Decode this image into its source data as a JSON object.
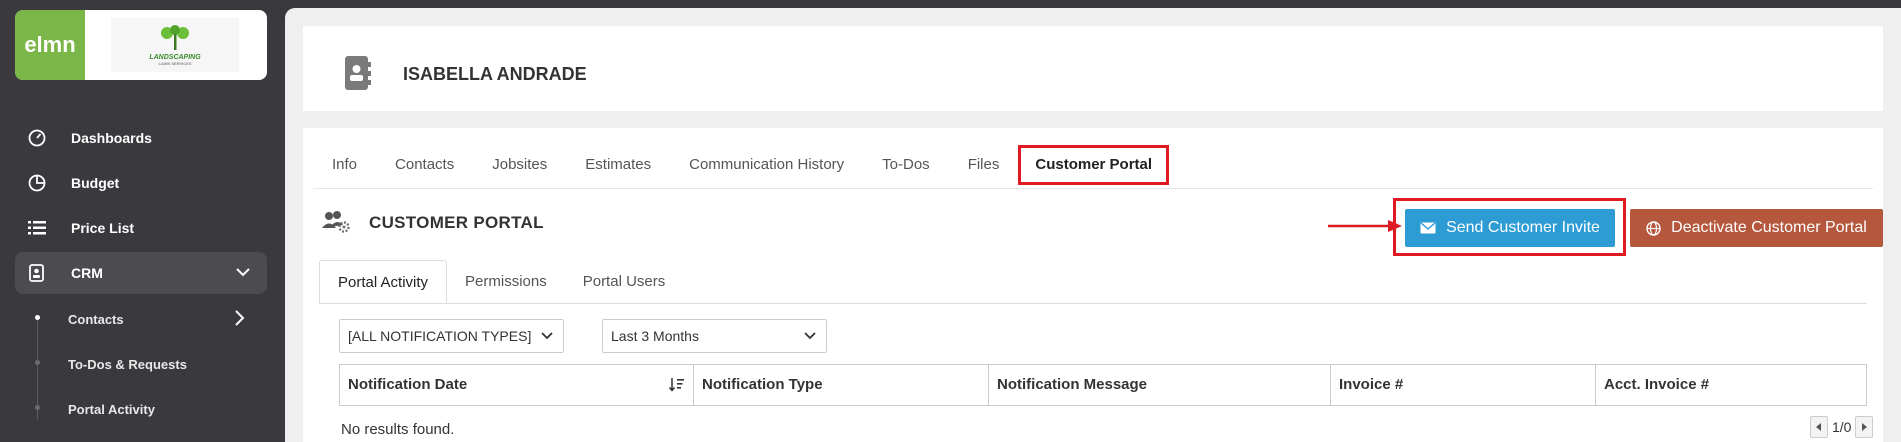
{
  "brand": {
    "app_logo": "elmn",
    "company_logo_text": "LANDSCAPING",
    "company_logo_subtext": "LAWN SERVICES",
    "accent": "#7ab648"
  },
  "sidebar": {
    "items": [
      {
        "label": "Dashboards",
        "icon": "gauge-icon"
      },
      {
        "label": "Budget",
        "icon": "pie-chart-icon"
      },
      {
        "label": "Price List",
        "icon": "list-icon"
      },
      {
        "label": "CRM",
        "icon": "contact-book-icon"
      }
    ],
    "crm_sub": [
      {
        "label": "Contacts"
      },
      {
        "label": "To-Dos & Requests"
      },
      {
        "label": "Portal Activity"
      }
    ]
  },
  "header": {
    "contact_name": "ISABELLA ANDRADE"
  },
  "tabs": [
    {
      "label": "Info"
    },
    {
      "label": "Contacts"
    },
    {
      "label": "Jobsites"
    },
    {
      "label": "Estimates"
    },
    {
      "label": "Communication History"
    },
    {
      "label": "To-Dos"
    },
    {
      "label": "Files"
    },
    {
      "label": "Customer Portal"
    }
  ],
  "portal": {
    "title": "CUSTOMER PORTAL",
    "send_invite_label": "Send Customer Invite",
    "deactivate_label": "Deactivate Customer Portal",
    "invite_color": "#2e9cd4",
    "deactivate_color": "#b5573c",
    "highlight_color": "#e01a22"
  },
  "subtabs": [
    {
      "label": "Portal Activity"
    },
    {
      "label": "Permissions"
    },
    {
      "label": "Portal Users"
    }
  ],
  "filters": {
    "notification_type": "[ALL NOTIFICATION TYPES]",
    "date_range": "Last 3 Months"
  },
  "table": {
    "columns": [
      "Notification Date",
      "Notification Type",
      "Notification Message",
      "Invoice #",
      "Acct. Invoice #"
    ],
    "empty_text": "No results found."
  },
  "pager": {
    "text": "1/0"
  }
}
